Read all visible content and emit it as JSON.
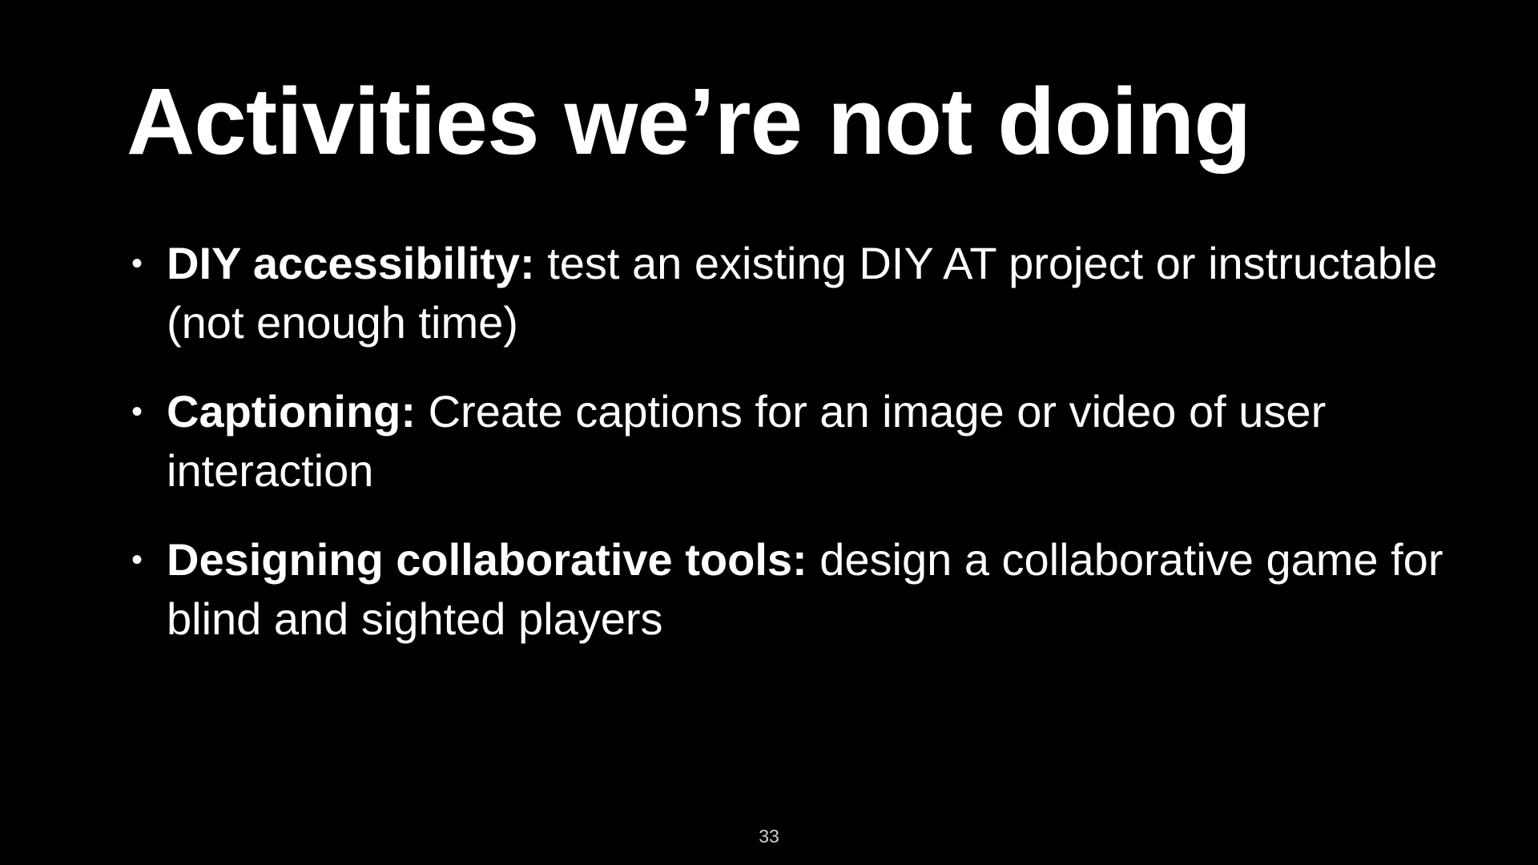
{
  "slide": {
    "title": "Activities we’re not doing",
    "bullets": [
      {
        "term": "DIY accessibility:",
        "text": "test an existing DIY AT project or instructable (not enough time)"
      },
      {
        "term": "Captioning:",
        "text": "Create captions for an image or video of user interaction"
      },
      {
        "term": "Designing collaborative tools:",
        "text": "design a collaborative game for blind and sighted players"
      }
    ],
    "bullet_symbol": "•",
    "page_number": "33"
  },
  "colors": {
    "background": "#000000",
    "text": "#ffffff"
  }
}
